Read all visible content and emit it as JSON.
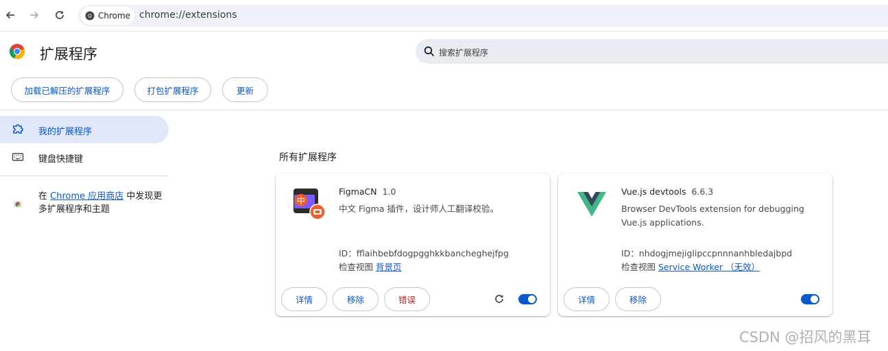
{
  "browser": {
    "chip_label": "Chrome",
    "url": "chrome://extensions"
  },
  "header": {
    "title": "扩展程序",
    "search_placeholder": "搜索扩展程序"
  },
  "toolbar": {
    "load_unpacked": "加载已解压的扩展程序",
    "pack": "打包扩展程序",
    "update": "更新"
  },
  "sidebar": {
    "items": [
      {
        "label": "我的扩展程序",
        "active": true,
        "icon": "puzzle-icon"
      },
      {
        "label": "键盘快捷键",
        "active": false,
        "icon": "keyboard-icon"
      }
    ],
    "store_prefix": "在 ",
    "store_link": "Chrome 应用商店",
    "store_suffix": " 中发现更多扩展程序和主题"
  },
  "main": {
    "section_title": "所有扩展程序",
    "extensions": [
      {
        "name": "FigmaCN",
        "version": "1.0",
        "description": "中文 Figma 插件，设计师人工翻译校验。",
        "id_text": "ID：fflaihbebfdogpgghkkbancheghejfpg",
        "inspect_label": "检查视图 ",
        "inspect_link": "背景页",
        "details": "详情",
        "remove": "移除",
        "errors": "错误",
        "enabled": true
      },
      {
        "name": "Vue.js devtools",
        "version": "6.6.3",
        "description": "Browser DevTools extension for debugging Vue.js applications.",
        "id_text": "ID：nhdogjmejiglipccpnnnanhbledajbpd",
        "inspect_label": "检查视图 ",
        "inspect_link": "Service Worker （无效）",
        "details": "详情",
        "remove": "移除",
        "enabled": true
      }
    ]
  },
  "watermark": "CSDN @招风的黑耳",
  "colors": {
    "accent": "#0b57d0",
    "error": "#b3261e",
    "active_bg": "#dfe7f8"
  }
}
